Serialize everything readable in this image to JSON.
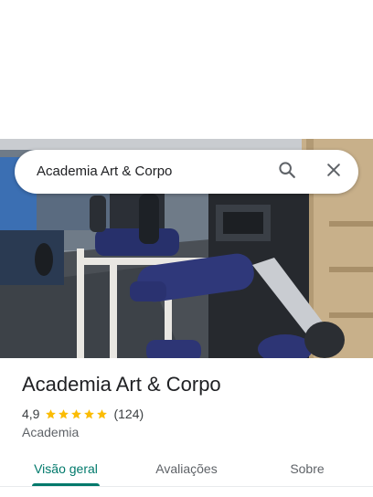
{
  "search": {
    "query": "Academia Art & Corpo",
    "search_icon": "search-icon",
    "close_icon": "close-icon"
  },
  "place": {
    "name": "Academia Art & Corpo",
    "rating_text": "4,9",
    "rating_value": 4.9,
    "star_count": 5,
    "reviews": "(124)",
    "category": "Academia"
  },
  "tabs": [
    {
      "label": "Visão geral",
      "active": true
    },
    {
      "label": "Avaliações",
      "active": false
    },
    {
      "label": "Sobre",
      "active": false
    }
  ],
  "colors": {
    "accent": "#00796b",
    "star": "#fbbc04",
    "text_primary": "#202124",
    "text_secondary": "#5f6368"
  }
}
